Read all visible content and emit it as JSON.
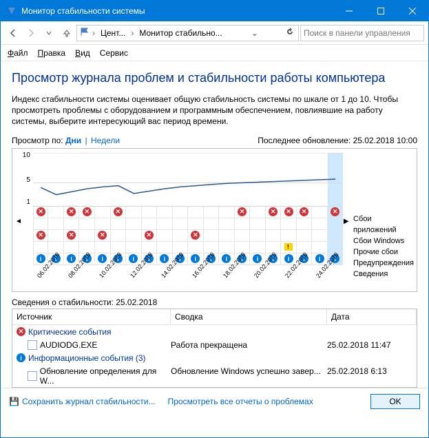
{
  "window": {
    "title": "Монитор стабильности системы"
  },
  "breadcrumb": {
    "c1": "Цент...",
    "c2": "Монитор стабильно..."
  },
  "search": {
    "placeholder": "Поиск в панели управления"
  },
  "menu": {
    "file": "Файл",
    "edit": "Правка",
    "view": "Вид",
    "tools": "Сервис"
  },
  "heading": "Просмотр журнала проблем и стабильности работы компьютера",
  "description": "Индекс стабильности системы оценивает общую стабильность системы по шкале от 1 до 10. Чтобы просмотреть проблемы с оборудованием и программным обеспечением, повлиявшие на работу системы, выберите интересующий вас период времени.",
  "viewby": {
    "label": "Просмотр по:",
    "days": "Дни",
    "weeks": "Недели"
  },
  "lastupdate": {
    "label": "Последнее обновление:",
    "value": "25.02.2018 10:00"
  },
  "chart_data": {
    "type": "line",
    "ylim": [
      1,
      10
    ],
    "yticks": [
      1,
      5,
      10
    ],
    "dates": [
      "06.02.2018",
      "",
      "08.02.2018",
      "",
      "10.02.2018",
      "",
      "12.02.2018",
      "",
      "14.02.2018",
      "",
      "16.02.2018",
      "",
      "18.02.2018",
      "",
      "20.02.2018",
      "",
      "22.02.2018",
      "",
      "24.02.2018",
      ""
    ],
    "stability": [
      4.2,
      3.0,
      3.5,
      4.0,
      4.3,
      4.5,
      3.2,
      3.6,
      4.0,
      4.3,
      4.5,
      4.7,
      4.9,
      5.0,
      5.1,
      5.2,
      5.3,
      5.4,
      5.5,
      5.6
    ],
    "selected_index": 19,
    "rows": {
      "app_failures": [
        "x",
        "",
        "x",
        "x",
        "",
        "x",
        "",
        "",
        "",
        "",
        "",
        "",
        "",
        "x",
        "",
        "x",
        "x",
        "x",
        "",
        "x"
      ],
      "win_failures": [
        "",
        "",
        "",
        "",
        "",
        "",
        "",
        "",
        "",
        "",
        "",
        "",
        "",
        "",
        "",
        "",
        "",
        "",
        "",
        ""
      ],
      "misc_failures": [
        "x",
        "",
        "x",
        "",
        "x",
        "",
        "",
        "x",
        "",
        "",
        "x",
        "",
        "",
        "",
        "",
        "",
        "",
        "",
        "",
        ""
      ],
      "warnings": [
        "",
        "",
        "",
        "",
        "",
        "",
        "",
        "",
        "",
        "",
        "",
        "",
        "",
        "",
        "",
        "",
        "w",
        "",
        "",
        ""
      ],
      "info": [
        "i",
        "i",
        "i",
        "i",
        "i",
        "i",
        "i",
        "i",
        "i",
        "i",
        "i",
        "i",
        "i",
        "i",
        "i",
        "i",
        "i",
        "i",
        "i",
        "i"
      ]
    }
  },
  "legend": {
    "app": "Сбои приложений",
    "win": "Сбои Windows",
    "misc": "Прочие сбои",
    "warn": "Предупреждения",
    "info": "Сведения"
  },
  "details": {
    "header_prefix": "Сведения о стабильности:",
    "header_date": "25.02.2018",
    "cols": {
      "source": "Источник",
      "summary": "Сводка",
      "date": "Дата"
    },
    "group_critical": "Критические события",
    "group_info": "Информационные события (3)",
    "rows": [
      {
        "source": "AUDIODG.EXE",
        "summary": "Работа прекращена",
        "date": "25.02.2018 11:47",
        "group": "critical"
      },
      {
        "source": "Обновление определения для W...",
        "summary": "Обновление Windows успешно завер...",
        "date": "25.02.2018 6:13",
        "group": "info"
      }
    ]
  },
  "footer": {
    "save": "Сохранить журнал стабильности...",
    "viewall": "Просмотреть все отчеты о проблемах",
    "ok": "OK"
  }
}
